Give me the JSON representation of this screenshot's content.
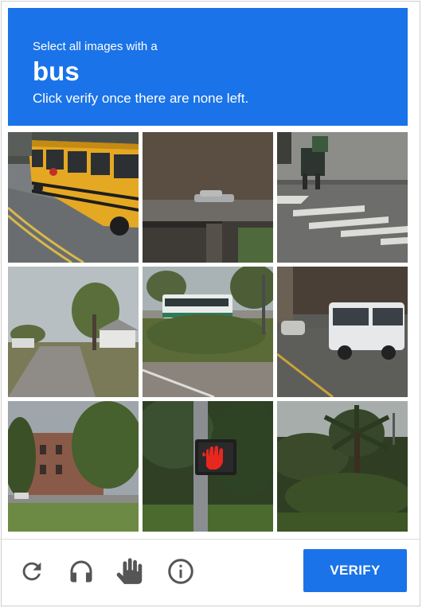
{
  "header": {
    "instruction": "Select all images with a",
    "target": "bus",
    "hint": "Click verify once there are none left."
  },
  "tiles": [
    {
      "id": 1,
      "subject": "school bus front"
    },
    {
      "id": 2,
      "subject": "car on overpass"
    },
    {
      "id": 3,
      "subject": "pedestrians on crosswalk"
    },
    {
      "id": 4,
      "subject": "suburban road with trees"
    },
    {
      "id": 5,
      "subject": "transit bus behind bushes"
    },
    {
      "id": 6,
      "subject": "white shuttle bus on street"
    },
    {
      "id": 7,
      "subject": "brick building with trees"
    },
    {
      "id": 8,
      "subject": "pedestrian signal red hand"
    },
    {
      "id": 9,
      "subject": "palm tree and hedges"
    }
  ],
  "footer": {
    "icons": [
      "reload-icon",
      "audio-headphones-icon",
      "hand-icon",
      "info-icon"
    ],
    "verify_label": "VERIFY"
  },
  "colors": {
    "accent": "#1a73e8",
    "icon_gray": "#555555"
  }
}
